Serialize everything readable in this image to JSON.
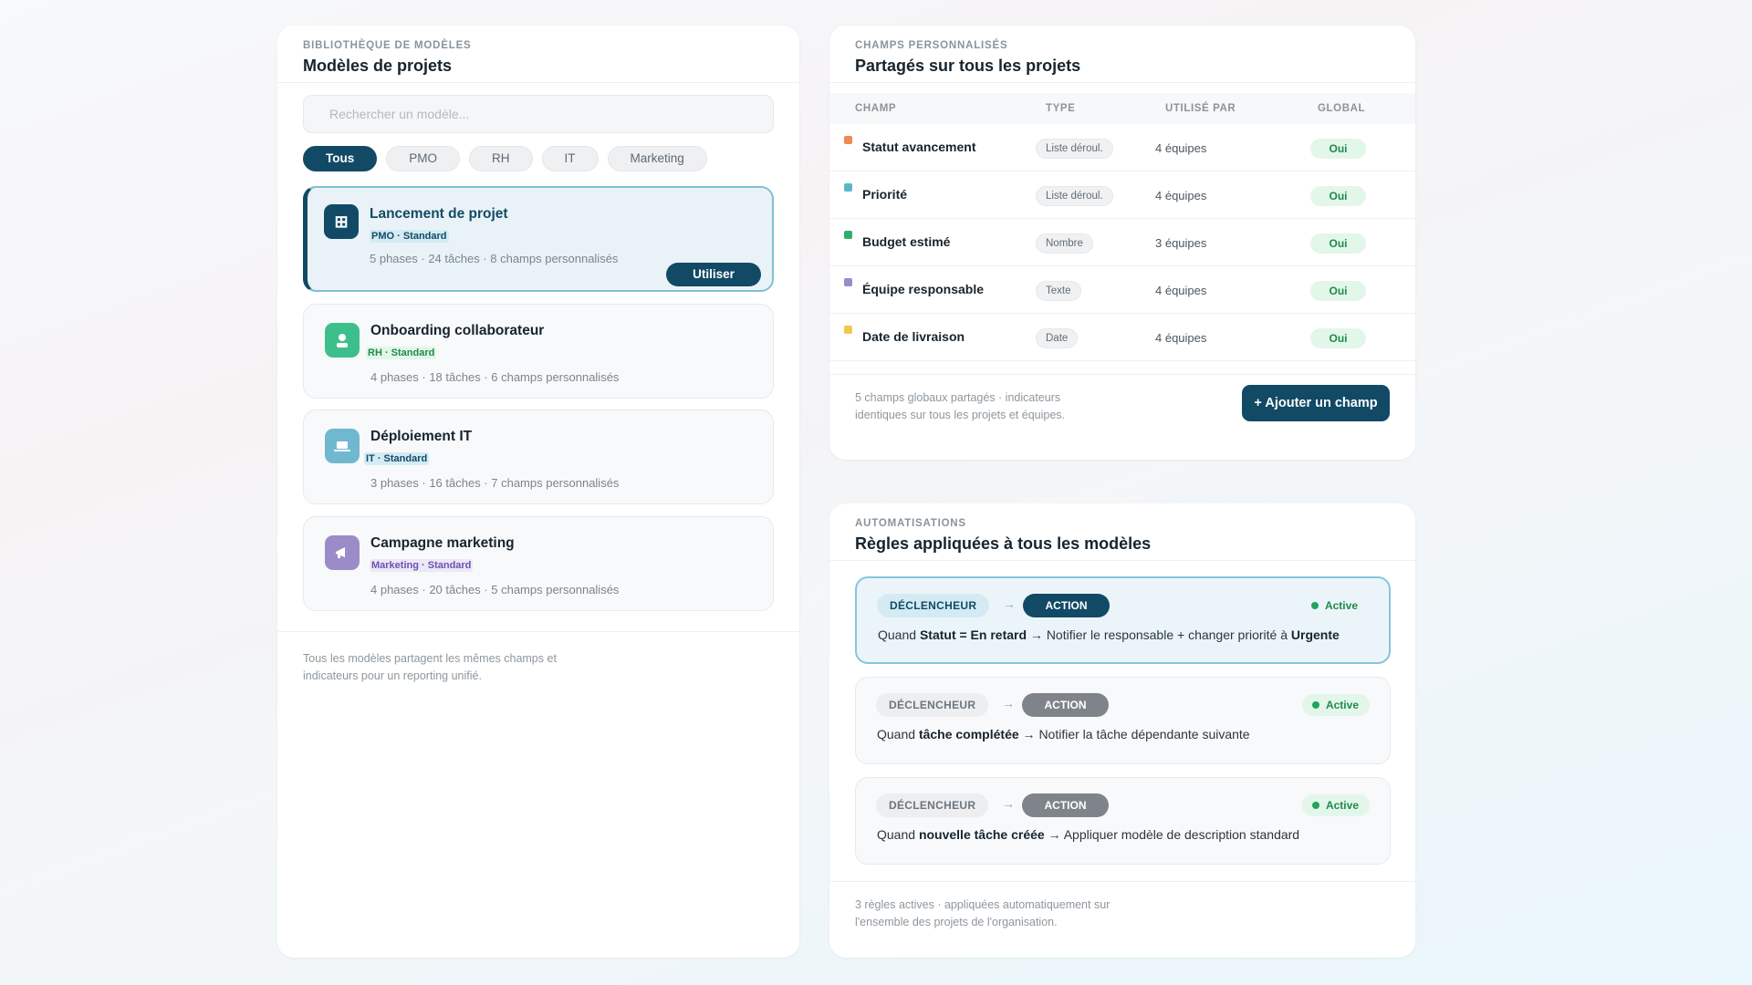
{
  "templates_panel": {
    "eyebrow": "BIBLIOTHÈQUE DE MODÈLES",
    "title": "Modèles de projets",
    "search_placeholder": "Rechercher un modèle...",
    "filters": [
      "Tous",
      "PMO",
      "RH",
      "IT",
      "Marketing"
    ],
    "active_filter": "Tous",
    "templates": [
      {
        "name": "Lancement de projet",
        "tag": "PMO · Standard",
        "meta": "5 phases · 24 tâches · 8 champs personnalisés",
        "icon": "grid-icon",
        "color": "#124a66",
        "tag_color": "#124a66",
        "selected": true,
        "action": "Utiliser"
      },
      {
        "name": "Onboarding collaborateur",
        "tag": "RH · Standard",
        "meta": "4 phases · 18 tâches · 6 champs personnalisés",
        "icon": "person-icon",
        "color": "#3dbf8c",
        "tag_color": "#1f8a4c"
      },
      {
        "name": "Déploiement IT",
        "tag": "IT · Standard",
        "meta": "3 phases · 16 tâches · 7 champs personnalisés",
        "icon": "laptop-icon",
        "color": "#6fb8cf",
        "tag_color": "#124a66"
      },
      {
        "name": "Campagne marketing",
        "tag": "Marketing · Standard",
        "meta": "4 phases · 20 tâches · 5 champs personnalisés",
        "icon": "megaphone-icon",
        "color": "#9b8cc9",
        "tag_color": "#6a52b0"
      }
    ],
    "footer": "Tous les modèles partagent les mêmes champs et indicateurs pour un reporting unifié."
  },
  "fields_panel": {
    "eyebrow": "CHAMPS PERSONNALISÉS",
    "title": "Partagés sur tous les projets",
    "columns": [
      "CHAMP",
      "TYPE",
      "UTILISÉ PAR",
      "GLOBAL"
    ],
    "rows": [
      {
        "name": "Statut avancement",
        "type": "Liste déroul.",
        "used_by": "4 équipes",
        "global": "Oui",
        "color": "#f0894f"
      },
      {
        "name": "Priorité",
        "type": "Liste déroul.",
        "used_by": "4 équipes",
        "global": "Oui",
        "color": "#5bb6c9"
      },
      {
        "name": "Budget estimé",
        "type": "Nombre",
        "used_by": "3 équipes",
        "global": "Oui",
        "color": "#2fae6b"
      },
      {
        "name": "Équipe responsable",
        "type": "Texte",
        "used_by": "4 équipes",
        "global": "Oui",
        "color": "#9b8cc9"
      },
      {
        "name": "Date de livraison",
        "type": "Date",
        "used_by": "4 équipes",
        "global": "Oui",
        "color": "#f2c94c"
      }
    ],
    "footer": "5 champs globaux partagés · indicateurs identiques sur tous les projets et équipes.",
    "add_button": "+ Ajouter un champ"
  },
  "automations_panel": {
    "eyebrow": "AUTOMATISATIONS",
    "title": "Règles appliquées à tous les modèles",
    "trigger_label": "DÉCLENCHEUR",
    "arrow": "→",
    "action_label": "ACTION",
    "status": "Active",
    "rules": [
      {
        "when": "Quand",
        "cond": "Statut = En retard",
        "sep": "→",
        "action": "Notifier le responsable + changer priorité à",
        "target": "Urgente"
      },
      {
        "when": "Quand",
        "cond": "tâche complétée",
        "sep": "→",
        "action": "Notifier la tâche dépendante suivante",
        "target": ""
      },
      {
        "when": "Quand",
        "cond": "nouvelle tâche créée",
        "sep": "→",
        "action": "Appliquer modèle de description standard",
        "target": ""
      }
    ],
    "footer": "3 règles actives · appliquées automatiquement sur l'ensemble des projets de l'organisation."
  }
}
